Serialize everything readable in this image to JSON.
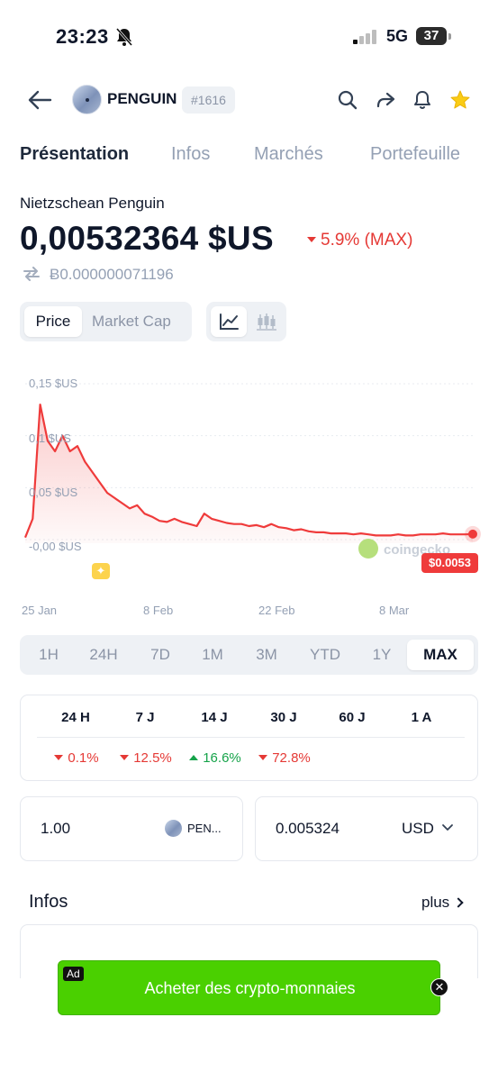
{
  "status": {
    "time": "23:23",
    "network": "5G",
    "battery": "37"
  },
  "header": {
    "coin_name": "PENGUIN",
    "rank": "#1616"
  },
  "tabs": [
    {
      "label": "Présentation"
    },
    {
      "label": "Infos"
    },
    {
      "label": "Marchés"
    },
    {
      "label": "Portefeuille"
    }
  ],
  "coin": {
    "full_name": "Nietzschean Penguin",
    "price": "0,00532364 $US",
    "change": "5.9% (MAX)",
    "btc_price": "Ƀ0.000000071196"
  },
  "toggle": {
    "price_label": "Price",
    "market_cap_label": "Market Cap"
  },
  "chart": {
    "current_price_tag": "$0.0053",
    "watermark": "coingecko",
    "y_ticks": [
      "0,15 $US",
      "0,1 $US",
      "0,05 $US",
      "-0,00 $US"
    ],
    "x_ticks": [
      "25 Jan",
      "8 Feb",
      "22 Feb",
      "8 Mar"
    ]
  },
  "chart_data": {
    "type": "line",
    "ylim": [
      -0.005,
      0.15
    ],
    "y_tick_values": [
      0.15,
      0.1,
      0.05,
      0.0
    ],
    "x": [
      0,
      1,
      2,
      3,
      4,
      5,
      6,
      7,
      8,
      9,
      10,
      11,
      12,
      13,
      14,
      15,
      16,
      17,
      18,
      19,
      20,
      21,
      22,
      23,
      24,
      25,
      26,
      27,
      28,
      29,
      30,
      31,
      32,
      33,
      34,
      35,
      36,
      37,
      38,
      39,
      40,
      41,
      42,
      43,
      44,
      45,
      46,
      47,
      48,
      49,
      50,
      51,
      52,
      53,
      54,
      55,
      56,
      57,
      58,
      59,
      60
    ],
    "series": [
      {
        "values": [
          0.002,
          0.02,
          0.13,
          0.095,
          0.085,
          0.1,
          0.085,
          0.09,
          0.075,
          0.065,
          0.055,
          0.045,
          0.04,
          0.035,
          0.03,
          0.033,
          0.025,
          0.022,
          0.018,
          0.017,
          0.02,
          0.017,
          0.015,
          0.013,
          0.025,
          0.02,
          0.018,
          0.016,
          0.015,
          0.015,
          0.013,
          0.014,
          0.012,
          0.015,
          0.012,
          0.011,
          0.009,
          0.01,
          0.008,
          0.007,
          0.007,
          0.006,
          0.006,
          0.006,
          0.005,
          0.006,
          0.005,
          0.004,
          0.004,
          0.004,
          0.005,
          0.004,
          0.004,
          0.005,
          0.005,
          0.005,
          0.006,
          0.005,
          0.005,
          0.005,
          0.0053
        ]
      }
    ]
  },
  "timeframes": [
    "1H",
    "24H",
    "7D",
    "1M",
    "3M",
    "YTD",
    "1Y",
    "MAX"
  ],
  "performance": {
    "headers": [
      "24 H",
      "7 J",
      "14 J",
      "30 J",
      "60 J",
      "1 A"
    ],
    "values": [
      "0.1%",
      "12.5%",
      "16.6%",
      "72.8%"
    ]
  },
  "converter": {
    "amount": "1.00",
    "token": "PEN...",
    "fiat_value": "0.005324",
    "currency": "USD"
  },
  "infos": {
    "title": "Infos",
    "more_label": "plus"
  },
  "ad": {
    "tag": "Ad",
    "text": "Acheter des crypto-monnaies"
  },
  "colors": {
    "accent_down": "#e53935",
    "accent_up": "#16a34a",
    "ad_green": "#4ad000"
  }
}
